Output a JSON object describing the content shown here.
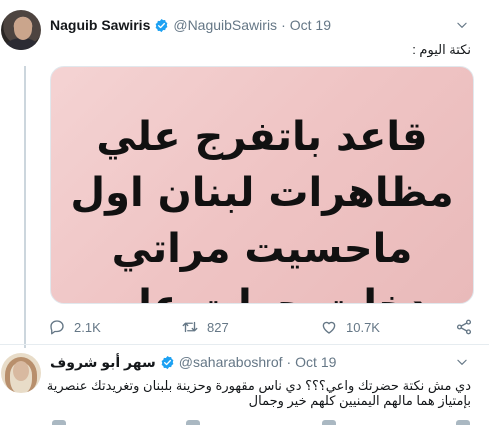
{
  "tweet1": {
    "name": "Naguib Sawiris",
    "handle": "@NaguibSawiris",
    "separator": "·",
    "date": "Oct 19",
    "text": "نكتة اليوم :",
    "media_text": [
      "قاعد باتفرج علي",
      "مظاهرات لبنان اول",
      "ماحسيت مراتي",
      "دخلت حولت علي"
    ],
    "replies": "2.1K",
    "retweets": "827",
    "likes": "10.7K"
  },
  "tweet2": {
    "name": "سهر أبو شروف",
    "handle": "@saharaboshrof",
    "separator": "·",
    "date": "Oct 19",
    "text_lines": [
      "دي مش نكتة حضرتك واعي؟؟؟ دي ناس مقهورة وحزينة بلبنان وتغريدتك عنصرية",
      "بإمتياز هما مالهم اليمنيين كلهم خير وجمال"
    ]
  },
  "icons": {
    "verified": "verified-badge-icon",
    "caret": "chevron-down-icon",
    "reply": "reply-icon",
    "retweet": "retweet-icon",
    "like": "heart-icon",
    "share": "share-icon"
  },
  "colors": {
    "verified_blue": "#1da1f2",
    "secondary_text": "#657786",
    "media_background": "#efc4c4"
  }
}
